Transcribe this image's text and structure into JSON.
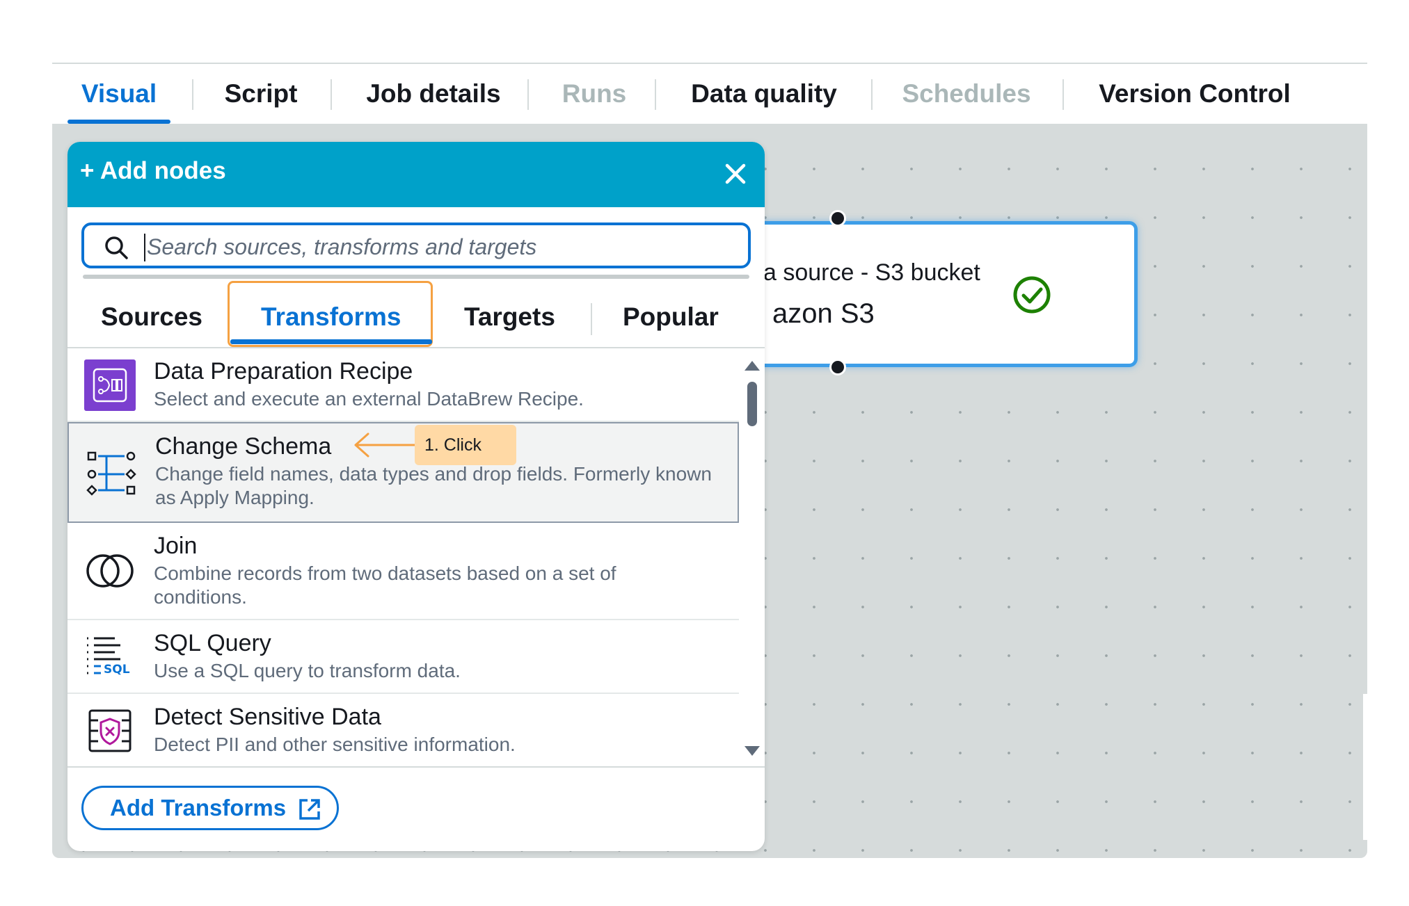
{
  "tabs": [
    {
      "label": "Visual",
      "state": "active"
    },
    {
      "label": "Script",
      "state": "enabled"
    },
    {
      "label": "Job details",
      "state": "enabled"
    },
    {
      "label": "Runs",
      "state": "disabled"
    },
    {
      "label": "Data quality",
      "state": "enabled"
    },
    {
      "label": "Schedules",
      "state": "disabled"
    },
    {
      "label": "Version Control",
      "state": "enabled"
    }
  ],
  "canvas_node": {
    "subtitle": "a source - S3 bucket",
    "title": "azon S3",
    "status_icon": "check-circle-icon",
    "status_color": "#1d8102"
  },
  "add_nodes_panel": {
    "title": "+ Add nodes",
    "close_icon": "close-icon",
    "search": {
      "placeholder": "Search sources, transforms and targets",
      "value": ""
    },
    "tabs": [
      {
        "label": "Sources"
      },
      {
        "label": "Transforms",
        "selected": true
      },
      {
        "label": "Targets"
      },
      {
        "label": "Popular"
      }
    ],
    "items": [
      {
        "icon": "databrew-recipe-icon",
        "title": "Data Preparation Recipe",
        "description": "Select and execute an external DataBrew Recipe."
      },
      {
        "icon": "change-schema-icon",
        "title": "Change Schema",
        "description": "Change field names, data types and drop fields. Formerly known as Apply Mapping.",
        "selected": true
      },
      {
        "icon": "join-icon",
        "title": "Join",
        "description": "Combine records from two datasets based on a set of conditions."
      },
      {
        "icon": "sql-query-icon",
        "title": "SQL Query",
        "description": "Use a SQL query to transform data."
      },
      {
        "icon": "detect-sensitive-data-icon",
        "title": "Detect Sensitive Data",
        "description": "Detect PII and other sensitive information."
      }
    ],
    "footer_button": {
      "label": "Add Transforms",
      "icon": "external-link-icon"
    }
  },
  "annotation": {
    "label": "1. Click",
    "color": "#ffd9a5",
    "arrow_color": "#f5a142"
  },
  "colors": {
    "accent": "#0972d3",
    "header": "#00a1c9",
    "canvas": "#d6dbdb"
  }
}
